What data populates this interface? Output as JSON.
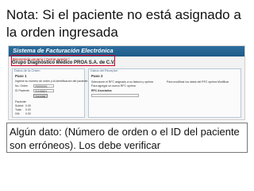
{
  "slide": {
    "title": "Nota: Si el paciente no está asignado a la orden ingresada",
    "note_arrow": "",
    "note": "Algún dato: (Número de orden o el ID del paciente son erróneos). Los debe verificar"
  },
  "screenshot": {
    "banner": "Sistema de Facturación Electrónica",
    "welcome": "Bienvenido usuario [ Cerrar sesión ]",
    "company": "Grupo Diagnóstico Médico PROA S.A. de C.V.",
    "left_panel": {
      "title": "Datos de la Orden",
      "step": "Paso 1",
      "instructions": "Ingrese su número de orden y la identificación del paciente",
      "label_order": "No. Orden",
      "order_value": "Z3000001",
      "label_id": "ID Paciente",
      "id_value": "31163601",
      "button": "Consultar",
      "summary_labels": [
        "Paciente:",
        "Subtot:",
        "Total:",
        "IVA:"
      ],
      "summary_values": [
        "",
        "0.00",
        "0.00",
        "0.00"
      ]
    },
    "right_panel": {
      "title": "Datos del Receptor",
      "step": "Paso 2",
      "line1": "Seleccione el RFC asignado a su factura y oprima",
      "line1_right": "Para modificar los datos del RFC oprima Modificar",
      "line2": "Para agregar un nuevo RFC oprima",
      "line3": "RFC Asociados"
    }
  }
}
